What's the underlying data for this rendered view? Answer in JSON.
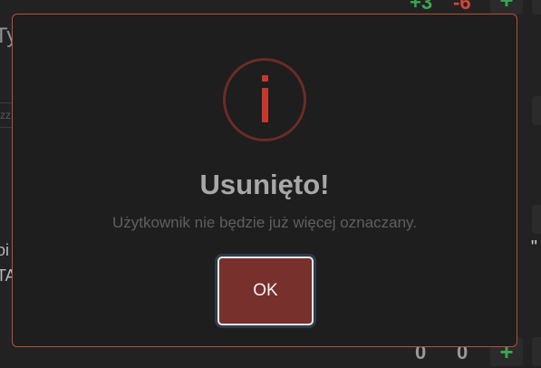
{
  "background": {
    "title_fragment": "Ty",
    "top_counters": {
      "positive": "+3",
      "negative": "-6"
    },
    "bottom_counters": {
      "left": "0",
      "right": "0"
    },
    "plus_symbol": "+",
    "input_placeholder_fragment": "zz",
    "left_text_fragments": [
      "oi",
      "TA"
    ],
    "quote_fragment": "\"",
    "colors": {
      "positive": "#3aa655",
      "negative": "#d2453a"
    }
  },
  "dialog": {
    "icon": "info-icon",
    "title": "Usunięto!",
    "message": "Użytkownik nie będzie już więcej oznaczany.",
    "ok_label": "OK",
    "colors": {
      "border": "#b4532e",
      "icon": "#c8372f",
      "button": "#77302b"
    }
  }
}
